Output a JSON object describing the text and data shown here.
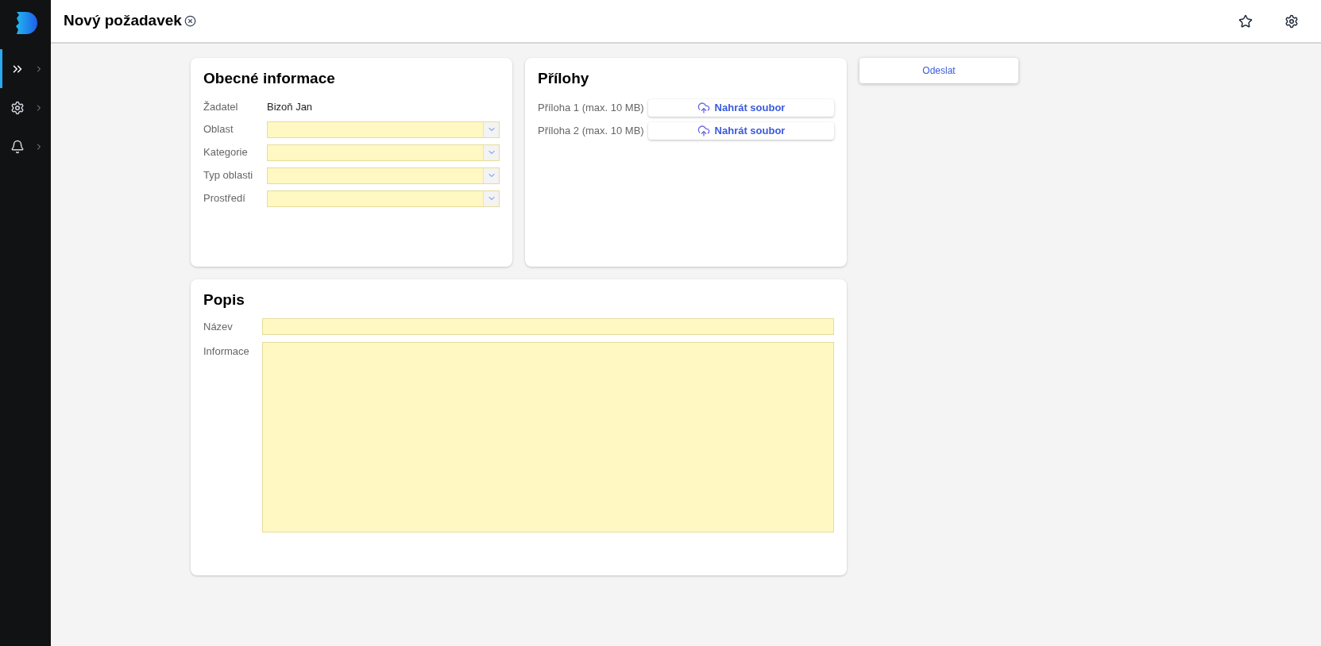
{
  "sidebar": {
    "items": [
      {
        "kind": "chevrons",
        "selected": true
      },
      {
        "kind": "gear",
        "selected": false
      },
      {
        "kind": "bell",
        "selected": false
      }
    ]
  },
  "header": {
    "title": "Nový požadavek"
  },
  "general": {
    "title": "Obecné informace",
    "requester": {
      "label": "Žadatel",
      "value": "Bizoň Jan"
    },
    "fields": [
      {
        "label": "Oblast"
      },
      {
        "label": "Kategorie"
      },
      {
        "label": "Typ oblasti"
      },
      {
        "label": "Prostředí"
      }
    ]
  },
  "attachments": {
    "title": "Přílohy",
    "items": [
      {
        "label": "Příloha 1 (max. 10 MB)",
        "button": "Nahrát soubor"
      },
      {
        "label": "Příloha 2 (max. 10 MB)",
        "button": "Nahrát soubor"
      }
    ]
  },
  "submit": "Odeslat",
  "description": {
    "title": "Popis",
    "name_label": "Název",
    "info_label": "Informace"
  }
}
